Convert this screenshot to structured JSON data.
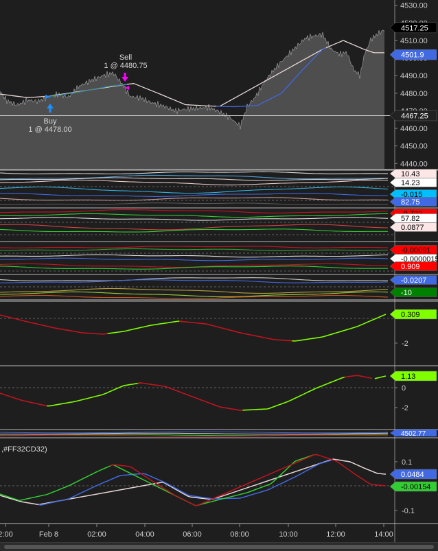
{
  "chart_data": [
    {
      "type": "line",
      "title": "",
      "x_labels": [
        "2:00",
        "Feb 8",
        "02:00",
        "04:00",
        "06:00",
        "08:00",
        "10:00",
        "12:00",
        "14:00"
      ],
      "ylim": [
        4437,
        4533
      ],
      "y_ticks": [
        4440,
        4450,
        4460,
        4470,
        4480,
        4490,
        4500,
        4510,
        4520,
        4530
      ],
      "y_tick_labels": [
        "4440.00",
        "4450.00",
        "4460.00",
        "4470.00",
        "4480.00",
        "4490.00",
        "4500.00",
        "4510.00",
        "4520.00",
        "4530.00"
      ],
      "price_labels": [
        {
          "text": "4517.25",
          "value": 4517.25,
          "color": "#000000",
          "text_color": "#ffffff"
        },
        {
          "text": "4501.9",
          "value": 4501.9,
          "color": "#4169e1",
          "text_color": "#ffffff"
        },
        {
          "text": "4467.25",
          "value": 4467.25,
          "color": "#222222",
          "text_color": "#ffffff"
        }
      ],
      "horizontal_line": 4467.25,
      "annotations": [
        {
          "kind": "buy",
          "label": "Buy",
          "detail": "1 @ 4478.00",
          "price": 4478.0
        },
        {
          "kind": "sell",
          "label": "Sell",
          "detail": "1 @ 4480.75",
          "price": 4480.75
        }
      ]
    },
    {
      "type": "line",
      "panel": "multi-indicator",
      "value_labels": [
        {
          "text": "10.43",
          "color": "#fce6e6",
          "text_color": "#000000"
        },
        {
          "text": "14.23",
          "color": "#ffffff",
          "text_color": "#000000"
        },
        {
          "text": "-0.015",
          "color": "#00bfff",
          "text_color": "#000000"
        },
        {
          "text": "82.75",
          "color": "#4169e1",
          "text_color": "#ffffff"
        },
        {
          "text": "-0.722",
          "color": "#ff0000",
          "text_color": "#000000"
        },
        {
          "text": "57.82",
          "color": "#ffffff",
          "text_color": "#000000"
        },
        {
          "text": "0.0877",
          "color": "#fce6e6",
          "text_color": "#000000"
        },
        {
          "text": "-0.00091",
          "color": "#ff0000",
          "text_color": "#000000"
        },
        {
          "text": "-0.0000015",
          "color": "#ffffff",
          "text_color": "#000000"
        },
        {
          "text": "0.909",
          "color": "#ff0000",
          "text_color": "#ffffff"
        },
        {
          "text": "-0.0207",
          "color": "#4169e1",
          "text_color": "#ffffff"
        },
        {
          "text": "-10",
          "color": "#008000",
          "text_color": "#ffffff"
        }
      ]
    },
    {
      "type": "line",
      "panel": "oscillator-1",
      "y_ticks": [
        -2
      ],
      "y_tick_labels": [
        "-2"
      ],
      "value_label": {
        "text": "0.309",
        "color": "#7fff00",
        "text_color": "#000000"
      }
    },
    {
      "type": "line",
      "panel": "oscillator-2",
      "y_ticks": [
        0,
        -2
      ],
      "y_tick_labels": [
        "0",
        "-2"
      ],
      "value_label": {
        "text": "1.13",
        "color": "#7fff00",
        "text_color": "#000000"
      }
    },
    {
      "type": "line",
      "panel": "thin-strip",
      "value_label": {
        "text": "4502.77",
        "color": "#4169e1",
        "text_color": "#ffffff"
      }
    },
    {
      "type": "line",
      "panel": "oscillator-3",
      "title": ",#FF32CD32)",
      "y_ticks": [
        0.1,
        -0.1
      ],
      "y_tick_labels": [
        "0.1",
        "-0.1"
      ],
      "value_labels": [
        {
          "text": "0.0484",
          "color": "#4169e1",
          "text_color": "#ffffff"
        },
        {
          "text": "-0.00154",
          "color": "#32cd32",
          "text_color": "#000000"
        }
      ]
    }
  ],
  "colors": {
    "background": "#1e1e1e",
    "price_fill": "#777777",
    "ma_white": "#e8d8d8",
    "ma_blue": "#4169e1",
    "osc_red": "#c0141e",
    "osc_green": "#7fff00",
    "green": "#32cd32",
    "buy_arrow": "#1e90ff",
    "sell_arrow": "#ff00ff"
  }
}
